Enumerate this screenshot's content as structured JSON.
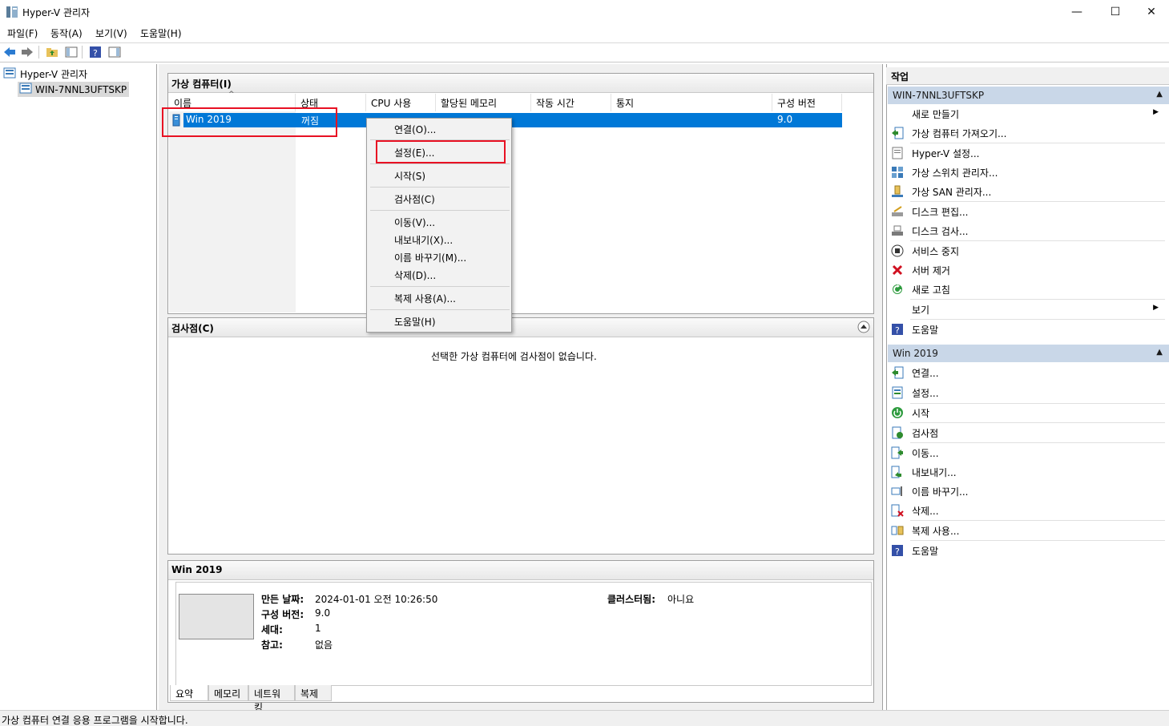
{
  "window": {
    "title": "Hyper-V 관리자",
    "minimize": "—",
    "maximize": "☐",
    "close": "✕"
  },
  "menu": [
    "파일(F)",
    "동작(A)",
    "보기(V)",
    "도움말(H)"
  ],
  "tree": {
    "root": "Hyper-V 관리자",
    "server": "WIN-7NNL3UFTSKP"
  },
  "vm_panel": {
    "title": "가상 컴퓨터(I)",
    "columns": [
      "이름",
      "상태",
      "CPU 사용",
      "할당된 메모리",
      "작동 시간",
      "통지",
      "구성 버전"
    ],
    "rows": [
      {
        "name": "Win 2019",
        "state": "꺼짐",
        "version": "9.0"
      }
    ]
  },
  "checkpoint_panel": {
    "title": "검사점(C)",
    "empty_message": "선택한 가상 컴퓨터에 검사점이 없습니다."
  },
  "detail_panel": {
    "title": "Win 2019",
    "created_label": "만든 날짜:",
    "created_value": "2024-01-01 오전 10:26:50",
    "version_label": "구성 버전:",
    "version_value": "9.0",
    "gen_label": "세대:",
    "gen_value": "1",
    "notes_label": "참고:",
    "notes_value": "없음",
    "cluster_label": "클러스터됨:",
    "cluster_value": "아니요",
    "tabs": [
      "요약",
      "메모리",
      "네트워킹",
      "복제"
    ]
  },
  "context_menu": {
    "connect": "연결(O)...",
    "settings": "설정(E)...",
    "start": "시작(S)",
    "checkpoint": "검사점(C)",
    "move": "이동(V)...",
    "export": "내보내기(X)...",
    "rename": "이름 바꾸기(M)...",
    "delete": "삭제(D)...",
    "replication": "복제 사용(A)...",
    "help": "도움말(H)"
  },
  "actions": {
    "title": "작업",
    "server_section": "WIN-7NNL3UFTSKP",
    "server_actions": {
      "new": "새로 만들기",
      "import": "가상 컴퓨터 가져오기...",
      "hv_settings": "Hyper-V 설정...",
      "switch_mgr": "가상 스위치 관리자...",
      "san_mgr": "가상 SAN 관리자...",
      "edit_disk": "디스크 편집...",
      "inspect_disk": "디스크 검사...",
      "stop_service": "서비스 중지",
      "remove_server": "서버 제거",
      "refresh": "새로 고침",
      "view": "보기",
      "help": "도움말"
    },
    "vm_section": "Win 2019",
    "vm_actions": {
      "connect": "연결...",
      "settings": "설정...",
      "start": "시작",
      "checkpoint": "검사점",
      "move": "이동...",
      "export": "내보내기...",
      "rename": "이름 바꾸기...",
      "delete": "삭제...",
      "replication": "복제 사용...",
      "help": "도움말"
    }
  },
  "status": "가상 컴퓨터 연결 응용 프로그램을 시작합니다.",
  "colors": {
    "selection": "#0078d7",
    "section_header": "#c9d7e8",
    "highlight_box": "#e81123"
  }
}
